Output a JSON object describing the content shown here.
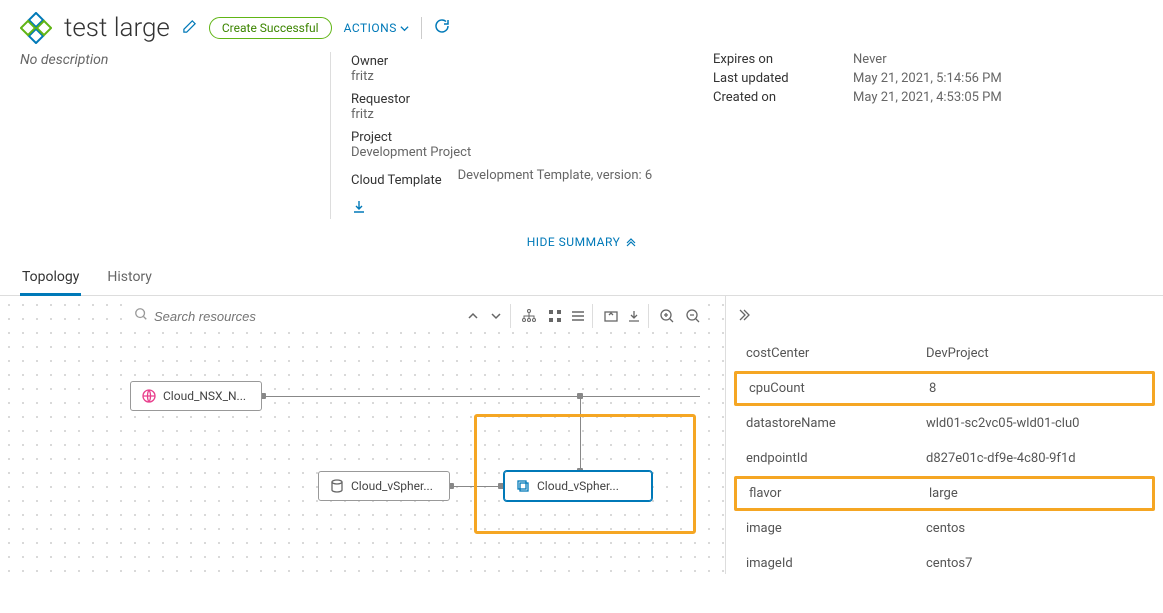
{
  "header": {
    "title": "test large",
    "status": "Create Successful",
    "actions_label": "ACTIONS"
  },
  "description": "No description",
  "summary": {
    "owner_label": "Owner",
    "owner": "fritz",
    "requestor_label": "Requestor",
    "requestor": "fritz",
    "project_label": "Project",
    "project": "Development Project",
    "cloud_template_label": "Cloud Template",
    "cloud_template": "Development Template, version: 6",
    "expires_label": "Expires on",
    "expires": "Never",
    "updated_label": "Last updated",
    "updated": "May 21, 2021, 5:14:56 PM",
    "created_label": "Created on",
    "created": "May 21, 2021, 4:53:05 PM"
  },
  "hide_summary_label": "HIDE SUMMARY",
  "tabs": {
    "topology": "Topology",
    "history": "History"
  },
  "search": {
    "placeholder": "Search resources"
  },
  "nodes": {
    "nsx": "Cloud_NSX_N...",
    "disk": "Cloud_vSpher...",
    "machine": "Cloud_vSpher..."
  },
  "properties": [
    {
      "key": "costCenter",
      "value": "DevProject",
      "highlight": false
    },
    {
      "key": "cpuCount",
      "value": "8",
      "highlight": true
    },
    {
      "key": "datastoreName",
      "value": "wld01-sc2vc05-wld01-clu0",
      "highlight": false
    },
    {
      "key": "endpointId",
      "value": "d827e01c-df9e-4c80-9f1d",
      "highlight": false
    },
    {
      "key": "flavor",
      "value": "large",
      "highlight": true
    },
    {
      "key": "image",
      "value": "centos",
      "highlight": false
    },
    {
      "key": "imageId",
      "value": "centos7",
      "highlight": false
    }
  ]
}
